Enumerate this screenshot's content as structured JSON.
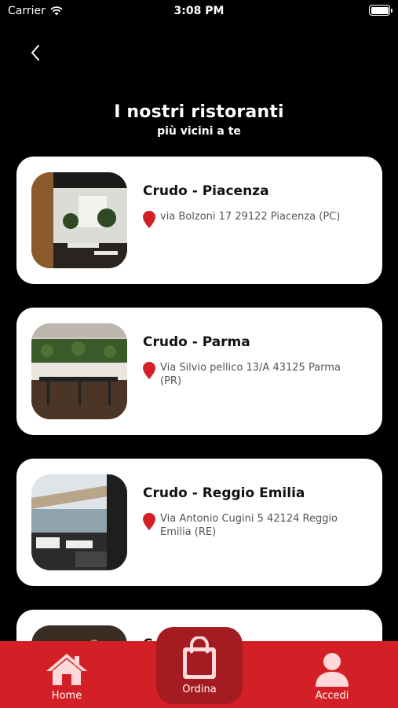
{
  "status_bar": {
    "carrier": "Carrier",
    "time": "3:08 PM"
  },
  "header": {
    "title": "I nostri ristoranti",
    "subtitle": "più vicini a te"
  },
  "restaurants": [
    {
      "name": "Crudo - Piacenza",
      "address": "via Bolzoni 17 29122 Piacenza (PC)"
    },
    {
      "name": "Crudo - Parma",
      "address": "Via Silvio pellico 13/A 43125 Parma (PR)"
    },
    {
      "name": "Crudo - Reggio Emilia",
      "address": "Via Antonio Cugini 5 42124 Reggio Emilia (RE)"
    },
    {
      "name": "C",
      "address": ""
    }
  ],
  "tabbar": {
    "home_label": "Home",
    "ordina_label": "Ordina",
    "accedi_label": "Accedi"
  },
  "colors": {
    "brand_red": "#d31f26",
    "brand_dark_red": "#a51b22",
    "pin_red": "#d31f26"
  }
}
